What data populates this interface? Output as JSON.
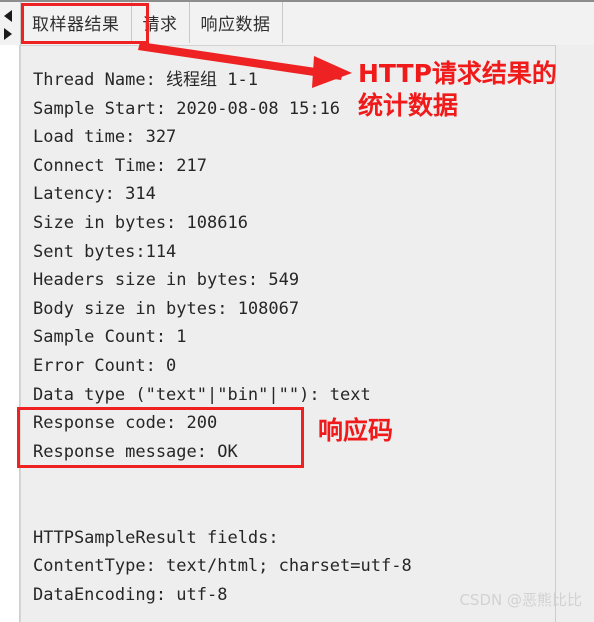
{
  "colors": {
    "annotation_red": "#ee2222",
    "panel_background": "#eeeeee",
    "tabbar_background": "#f2f2f2",
    "text": "#262626",
    "watermark": "#d2d2d2"
  },
  "tabbar": {
    "scroll_left_icon": "triangle-left-icon",
    "scroll_right_icon": "triangle-right-icon",
    "tabs": [
      {
        "label": "取样器结果",
        "selected": true
      },
      {
        "label": "请求",
        "selected": false
      },
      {
        "label": "响应数据",
        "selected": false
      }
    ]
  },
  "result": {
    "lines": [
      "Thread Name: 线程组 1-1",
      "Sample Start: 2020-08-08 15:16",
      "Load time: 327",
      "Connect Time: 217",
      "Latency: 314",
      "Size in bytes: 108616",
      "Sent bytes:114",
      "Headers size in bytes: 549",
      "Body size in bytes: 108067",
      "Sample Count: 1",
      "Error Count: 0",
      "Data type (\"text\"|\"bin\"|\"\"): text",
      "Response code: 200",
      "Response message: OK",
      "",
      "",
      "HTTPSampleResult fields:",
      "ContentType: text/html; charset=utf-8",
      "DataEncoding: utf-8"
    ],
    "fields": {
      "thread_name": "线程组 1-1",
      "sample_start": "2020-08-08 15:16",
      "load_time": "327",
      "connect_time": "217",
      "latency": "314",
      "size_in_bytes": "108616",
      "sent_bytes": "114",
      "headers_size_in_bytes": "549",
      "body_size_in_bytes": "108067",
      "sample_count": "1",
      "error_count": "0",
      "data_type": "text",
      "response_code": "200",
      "response_message": "OK",
      "content_type": "text/html; charset=utf-8",
      "data_encoding": "utf-8"
    }
  },
  "annotations": {
    "http_stats": "HTTP请求结果的\n统计数据",
    "response_code": "响应码"
  },
  "watermark": {
    "text": "CSDN @恶熊比比"
  }
}
